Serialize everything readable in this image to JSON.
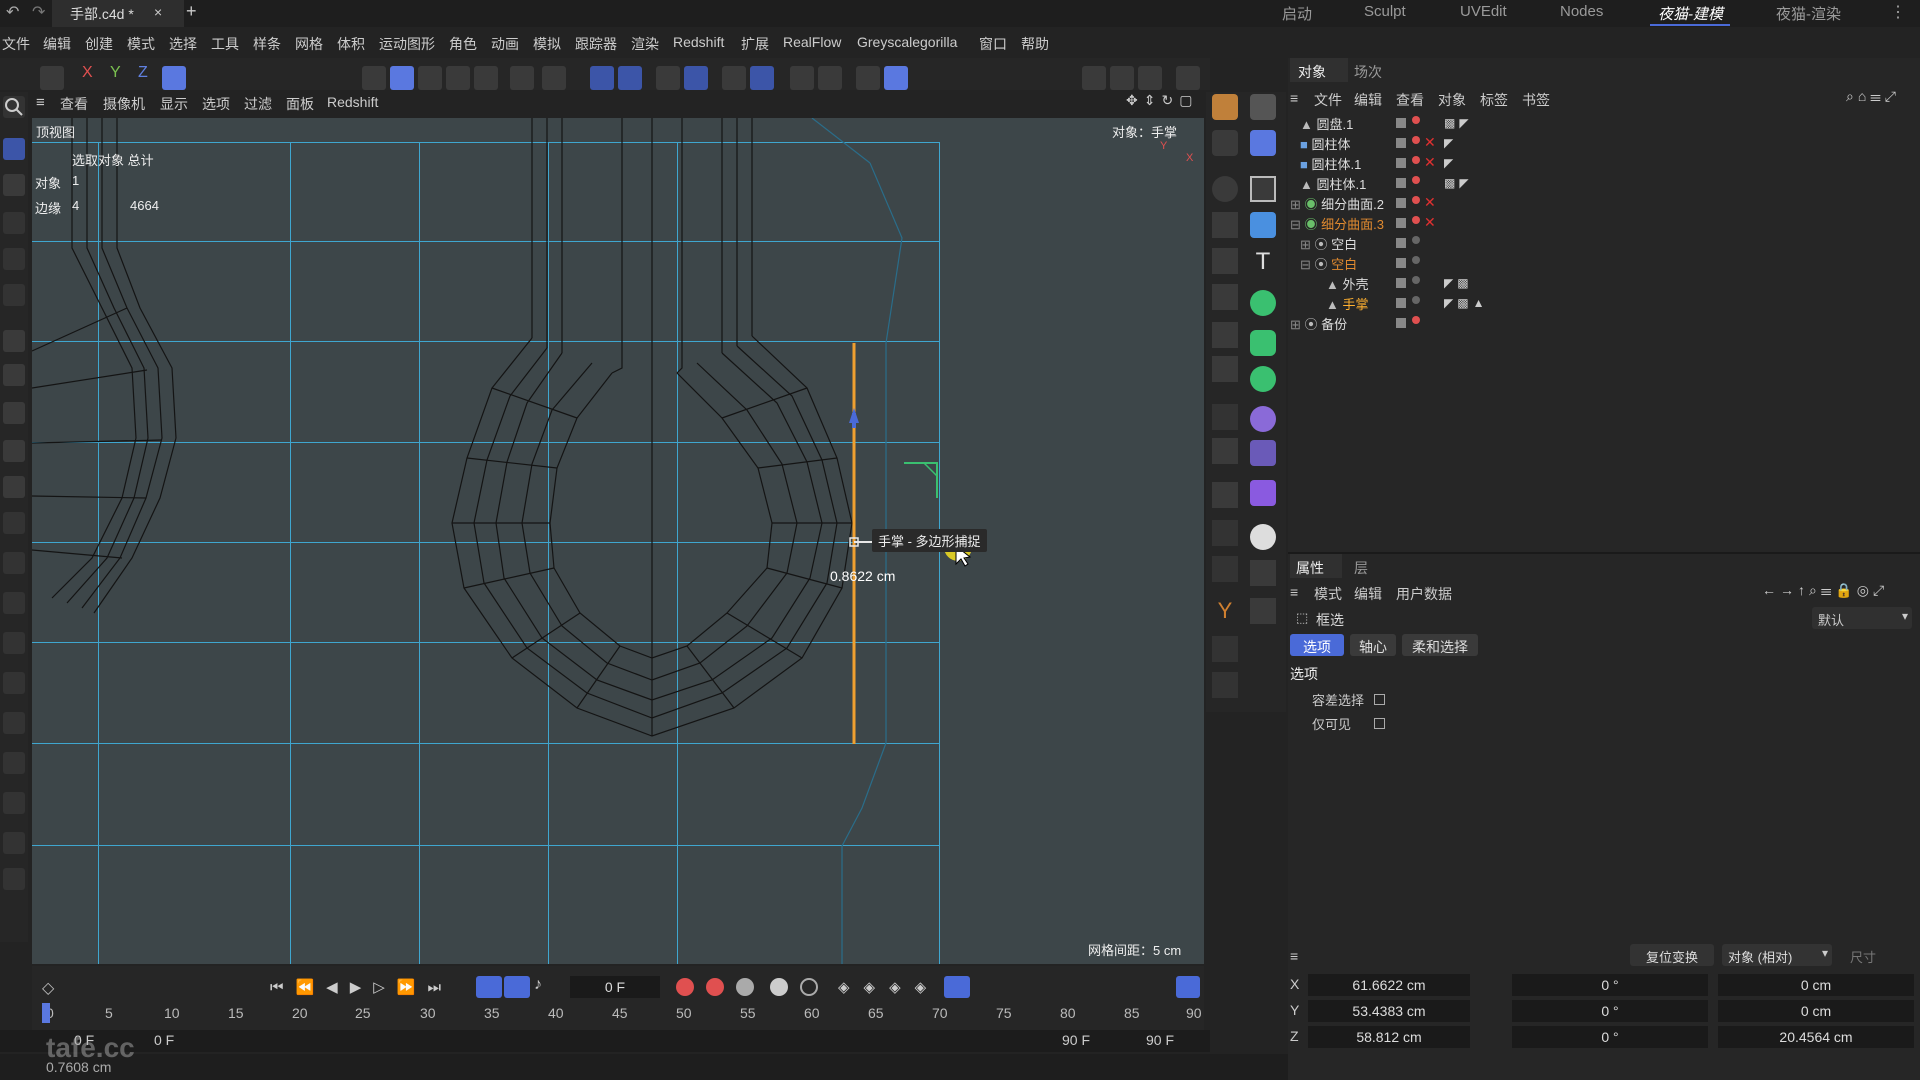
{
  "titlebar": {
    "file_tab": "手部.c4d *",
    "close": "×",
    "new_tab": "+",
    "layouts": [
      "启动",
      "Sculpt",
      "UVEdit",
      "Nodes",
      "夜猫-建模",
      "夜猫-渲染"
    ]
  },
  "menus": [
    "文件",
    "编辑",
    "创建",
    "模式",
    "选择",
    "工具",
    "样条",
    "网格",
    "体积",
    "运动图形",
    "角色",
    "动画",
    "模拟",
    "跟踪器",
    "渲染",
    "Redshift",
    "扩展",
    "RealFlow",
    "Greyscalegorilla",
    "窗口",
    "帮助"
  ],
  "toolbar": {
    "axes": [
      "X",
      "Y",
      "Z"
    ]
  },
  "viewport": {
    "menu": [
      "查看",
      "摄像机",
      "显示",
      "选项",
      "过滤",
      "面板",
      "Redshift"
    ],
    "view_name": "顶视图",
    "stats_header": "选取对象 总计",
    "stats_obj_label": "对象",
    "stats_obj_val": "1",
    "stats_edge_label": "边缘",
    "stats_edge_val": "4",
    "stats_edge_total": "4664",
    "object_label": "对象：手掌",
    "tooltip": "手掌 - 多边形捕捉",
    "measure": "0.8622 cm",
    "grid_spacing": "网格间距：5 cm",
    "axis_y": "Y",
    "axis_x": "X"
  },
  "timeline": {
    "frame": "0 F",
    "ticks": [
      "0",
      "5",
      "10",
      "15",
      "20",
      "25",
      "30",
      "35",
      "40",
      "45",
      "50",
      "55",
      "60",
      "65",
      "70",
      "75",
      "80",
      "85",
      "90"
    ],
    "start_a": "0 F",
    "start_b": "0 F",
    "end_a": "90 F",
    "end_b": "90 F"
  },
  "statusbar": {
    "text": "0.7608 cm",
    "watermark": "tafe.cc"
  },
  "objects_panel": {
    "tabs": [
      "对象",
      "场次"
    ],
    "menu": [
      "文件",
      "编辑",
      "查看",
      "对象",
      "标签",
      "书签"
    ],
    "items": [
      {
        "name": "圆盘.1",
        "color": "#dddddd"
      },
      {
        "name": "圆柱体",
        "color": "#dddddd"
      },
      {
        "name": "圆柱体.1",
        "color": "#dddddd"
      },
      {
        "name": "圆柱体.1",
        "color": "#dddddd"
      },
      {
        "name": "细分曲面.2",
        "color": "#dddddd"
      },
      {
        "name": "细分曲面.3",
        "color": "#e08a30"
      },
      {
        "name": "空白",
        "color": "#dddddd"
      },
      {
        "name": "空白",
        "color": "#e08a30"
      },
      {
        "name": "外壳",
        "color": "#dddddd"
      },
      {
        "name": "手掌",
        "color": "#ffb030"
      },
      {
        "name": "备份",
        "color": "#dddddd"
      }
    ]
  },
  "attributes_panel": {
    "tabs": [
      "属性",
      "层"
    ],
    "menu": [
      "模式",
      "编辑",
      "用户数据"
    ],
    "tool_name": "框选",
    "preset": "默认",
    "subtabs": [
      "选项",
      "轴心",
      "柔和选择"
    ],
    "section": "选项",
    "opt1": "容差选择",
    "opt2": "仅可见"
  },
  "coords": {
    "reset": "复位变换",
    "mode": "对象 (相对)",
    "size": "尺寸",
    "rows": [
      {
        "axis": "X",
        "pos": "61.6622 cm",
        "rot": "0 °",
        "size": "0 cm"
      },
      {
        "axis": "Y",
        "pos": "53.4383 cm",
        "rot": "0 °",
        "size": "0 cm"
      },
      {
        "axis": "Z",
        "pos": "58.812 cm",
        "rot": "0 °",
        "size": "20.4564 cm"
      }
    ]
  },
  "colors": {
    "accent": "#5a78e0",
    "selection": "#f0a030",
    "grid": "#3fa6cf",
    "viewport": "#3d4649"
  }
}
